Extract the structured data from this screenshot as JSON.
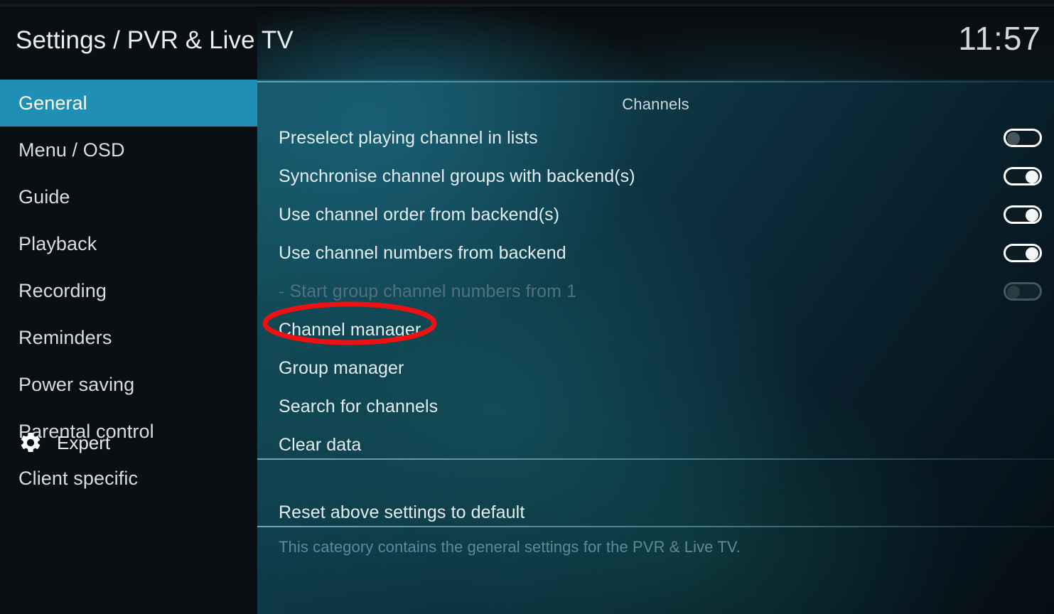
{
  "header": {
    "title": "Settings / PVR & Live TV",
    "clock": "11:57"
  },
  "sidebar": {
    "items": [
      {
        "label": "General",
        "active": true
      },
      {
        "label": "Menu / OSD",
        "active": false
      },
      {
        "label": "Guide",
        "active": false
      },
      {
        "label": "Playback",
        "active": false
      },
      {
        "label": "Recording",
        "active": false
      },
      {
        "label": "Reminders",
        "active": false
      },
      {
        "label": "Power saving",
        "active": false
      },
      {
        "label": "Parental control",
        "active": false
      },
      {
        "label": "Client specific",
        "active": false
      }
    ],
    "expert": {
      "label": "Expert",
      "icon": "gear-icon"
    }
  },
  "content": {
    "section_title": "Channels",
    "rows": [
      {
        "label": "Preselect playing channel in lists",
        "control": "toggle",
        "state": "off",
        "disabled": false
      },
      {
        "label": "Synchronise channel groups with backend(s)",
        "control": "toggle",
        "state": "on",
        "disabled": false
      },
      {
        "label": "Use channel order from backend(s)",
        "control": "toggle",
        "state": "on",
        "disabled": false
      },
      {
        "label": "Use channel numbers from backend",
        "control": "toggle",
        "state": "on",
        "disabled": false
      },
      {
        "label": "- Start group channel numbers from 1",
        "control": "toggle",
        "state": "disabled",
        "disabled": true
      },
      {
        "label": "Channel manager",
        "control": "none",
        "state": "",
        "disabled": false
      },
      {
        "label": "Group manager",
        "control": "none",
        "state": "",
        "disabled": false
      },
      {
        "label": "Search for channels",
        "control": "none",
        "state": "",
        "disabled": false
      },
      {
        "label": "Clear data",
        "control": "none",
        "state": "",
        "disabled": false
      },
      {
        "label": "Reset above settings to default",
        "control": "none",
        "state": "",
        "disabled": false
      }
    ],
    "description": "This category contains the general settings for the PVR & Live TV."
  },
  "annotation": {
    "shape": "ellipse",
    "color": "#ee1111",
    "target_label": "Channel manager"
  },
  "colors": {
    "accent": "#1f8fb5",
    "annotation_red": "#ee1111",
    "text_primary": "#e3edf0",
    "text_disabled": "#53717c",
    "text_description": "#5e899b"
  }
}
